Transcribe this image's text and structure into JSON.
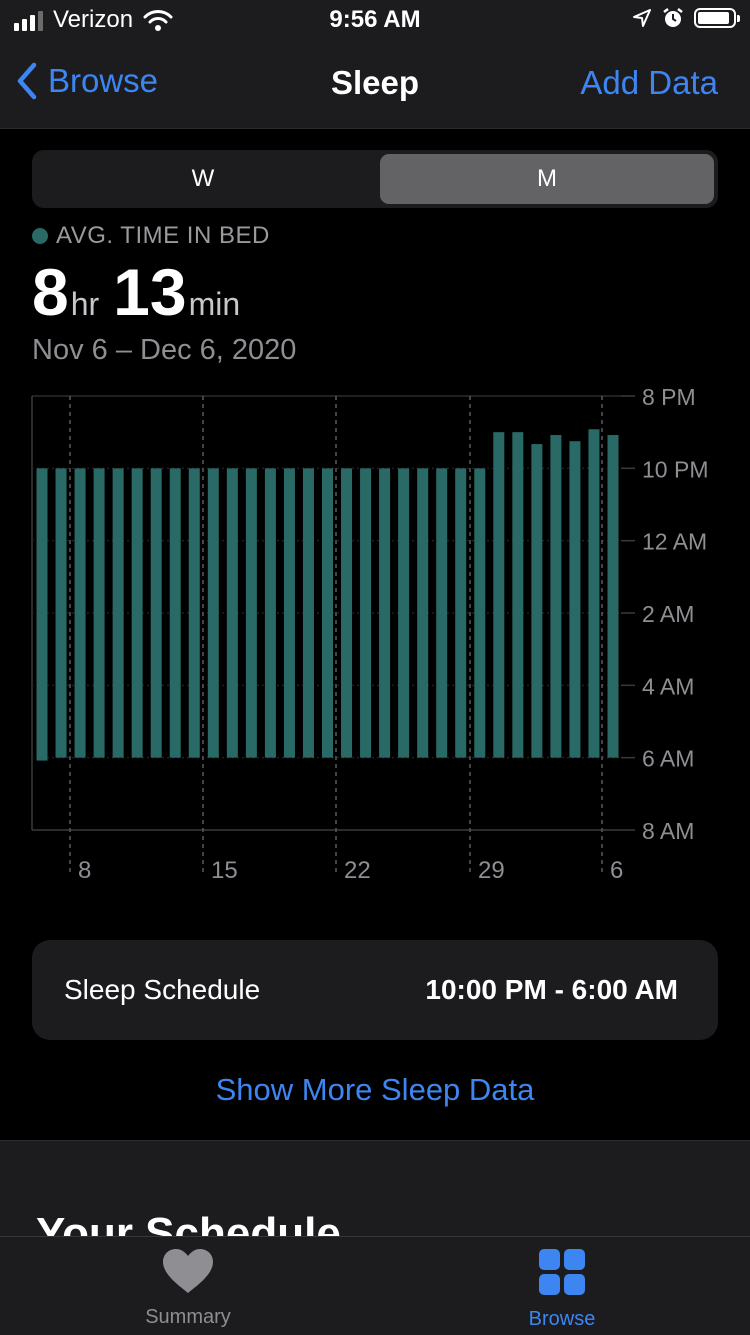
{
  "status_bar": {
    "carrier": "Verizon",
    "time": "9:56 AM"
  },
  "nav": {
    "back_label": "Browse",
    "title": "Sleep",
    "action_label": "Add Data"
  },
  "segments": {
    "week": "W",
    "month": "M",
    "selected": "M"
  },
  "summary": {
    "legend": "AVG. TIME IN BED",
    "hours": "8",
    "hours_unit": "hr",
    "minutes": "13",
    "minutes_unit": "min",
    "date_range": "Nov 6 – Dec 6, 2020"
  },
  "chart_data": {
    "type": "bar",
    "title": "",
    "xlabel": "",
    "ylabel": "",
    "x_tick_labels": [
      "8",
      "15",
      "22",
      "29",
      "6"
    ],
    "x_tick_days": [
      8,
      15,
      22,
      29,
      36
    ],
    "y_tick_labels": [
      "8 PM",
      "10 PM",
      "12 AM",
      "2 AM",
      "4 AM",
      "6 AM",
      "8 AM"
    ],
    "y_range_hours_after_8pm": [
      0,
      12
    ],
    "bar_color": "#2a6a66",
    "days": [
      6,
      7,
      8,
      9,
      10,
      11,
      12,
      13,
      14,
      15,
      16,
      17,
      18,
      19,
      20,
      21,
      22,
      23,
      24,
      25,
      26,
      27,
      28,
      29,
      30,
      31,
      32,
      33,
      34,
      35,
      36
    ],
    "bed_start": [
      "10:00 PM",
      "10:00 PM",
      "10:00 PM",
      "10:00 PM",
      "10:00 PM",
      "10:00 PM",
      "10:00 PM",
      "10:00 PM",
      "10:00 PM",
      "10:00 PM",
      "10:00 PM",
      "10:00 PM",
      "10:00 PM",
      "10:00 PM",
      "10:00 PM",
      "10:00 PM",
      "10:00 PM",
      "10:00 PM",
      "10:00 PM",
      "10:00 PM",
      "10:00 PM",
      "10:00 PM",
      "10:00 PM",
      "10:00 PM",
      "9:00 PM",
      "9:00 PM",
      "9:20 PM",
      "9:05 PM",
      "9:15 PM",
      "8:55 PM",
      "9:05 PM"
    ],
    "bed_end": [
      "6:05 AM",
      "6:00 AM",
      "6:00 AM",
      "6:00 AM",
      "6:00 AM",
      "6:00 AM",
      "6:00 AM",
      "6:00 AM",
      "6:00 AM",
      "6:00 AM",
      "6:00 AM",
      "6:00 AM",
      "6:00 AM",
      "6:00 AM",
      "6:00 AM",
      "6:00 AM",
      "6:00 AM",
      "6:00 AM",
      "6:00 AM",
      "6:00 AM",
      "6:00 AM",
      "6:00 AM",
      "6:00 AM",
      "6:00 AM",
      "6:00 AM",
      "6:00 AM",
      "6:00 AM",
      "6:00 AM",
      "6:00 AM",
      "6:00 AM",
      "6:00 AM"
    ],
    "bed_start_hours_after_8pm": [
      2,
      2,
      2,
      2,
      2,
      2,
      2,
      2,
      2,
      2,
      2,
      2,
      2,
      2,
      2,
      2,
      2,
      2,
      2,
      2,
      2,
      2,
      2,
      2,
      1.0,
      1.0,
      1.33,
      1.08,
      1.25,
      0.92,
      1.08
    ],
    "bed_end_hours_after_8pm": [
      10.08,
      10,
      10,
      10,
      10,
      10,
      10,
      10,
      10,
      10,
      10,
      10,
      10,
      10,
      10,
      10,
      10,
      10,
      10,
      10,
      10,
      10,
      10,
      10,
      10,
      10,
      10,
      10,
      10,
      10,
      10
    ]
  },
  "schedule": {
    "label": "Sleep Schedule",
    "value": "10:00 PM - 6:00 AM"
  },
  "link": {
    "show_more": "Show More Sleep Data"
  },
  "section": {
    "title": "Your Schedule"
  },
  "tabs": {
    "summary": "Summary",
    "browse": "Browse",
    "selected": "Browse"
  },
  "colors": {
    "accent": "#3d86f2",
    "bar": "#2a6a66",
    "background": "#000000",
    "card": "#1c1c1e"
  }
}
